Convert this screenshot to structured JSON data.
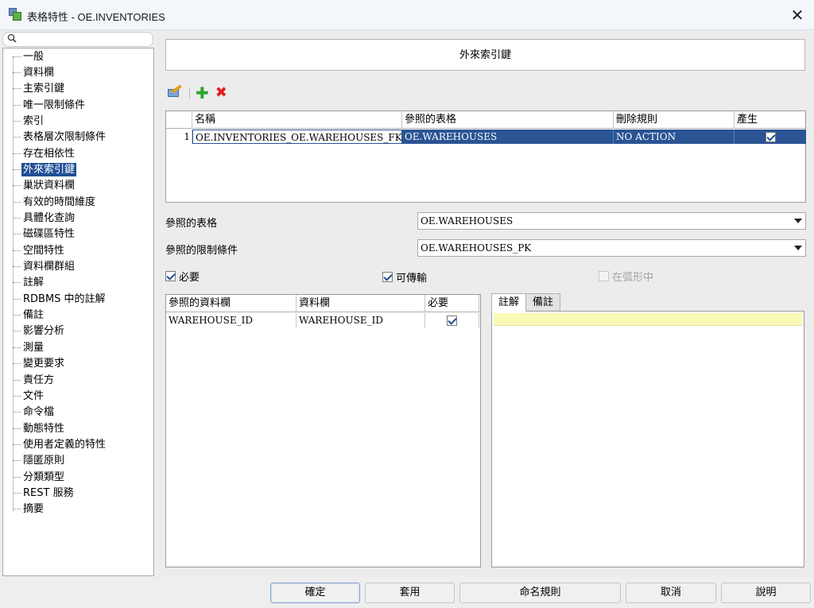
{
  "window": {
    "title": "表格特性 - OE.INVENTORIES",
    "close_glyph": "✕",
    "app_icon": "table-properties-icon"
  },
  "search": {
    "icon": "search-icon",
    "placeholder": ""
  },
  "tree": {
    "items": [
      {
        "label": "一般"
      },
      {
        "label": "資料欄"
      },
      {
        "label": "主索引鍵"
      },
      {
        "label": "唯一限制條件"
      },
      {
        "label": "索引"
      },
      {
        "label": "表格層次限制條件"
      },
      {
        "label": "存在相依性"
      },
      {
        "label": "外來索引鍵",
        "selected": true
      },
      {
        "label": "巢狀資料欄"
      },
      {
        "label": "有效的時間維度"
      },
      {
        "label": "具體化查詢"
      },
      {
        "label": "磁碟區特性"
      },
      {
        "label": "空間特性"
      },
      {
        "label": "資料欄群組"
      },
      {
        "label": "註解"
      },
      {
        "label": "RDBMS 中的註解"
      },
      {
        "label": "備註"
      },
      {
        "label": "影響分析"
      },
      {
        "label": "測量"
      },
      {
        "label": "變更要求"
      },
      {
        "label": "責任方"
      },
      {
        "label": "文件"
      },
      {
        "label": "命令檔"
      },
      {
        "label": "動態特性"
      },
      {
        "label": "使用者定義的特性"
      },
      {
        "label": "隱匿原則"
      },
      {
        "label": "分類類型"
      },
      {
        "label": "REST 服務"
      },
      {
        "label": "摘要"
      }
    ]
  },
  "main": {
    "section_title": "外來索引鍵",
    "toolbar": {
      "edit_icon": "edit-properties-icon",
      "add_icon": "add-icon",
      "add_glyph": "✚",
      "delete_icon": "delete-icon",
      "delete_glyph": "✖"
    },
    "fk_table": {
      "headers": [
        "名稱",
        "參照的表格",
        "刪除規則",
        "產生"
      ],
      "rows": [
        {
          "num": "1",
          "name": "OE.INVENTORIES_OE.WAREHOUSES_FK",
          "ref_table": "OE.WAREHOUSES",
          "delete_rule": "NO ACTION",
          "generate": true
        }
      ]
    },
    "ref_table_label": "參照的表格",
    "ref_table_value": "OE.WAREHOUSES",
    "ref_constraint_label": "參照的限制條件",
    "ref_constraint_value": "OE.WAREHOUSES_PK",
    "mandatory_label": "必要",
    "mandatory_checked": true,
    "transferable_label": "可傳輸",
    "transferable_checked": true,
    "in_arc_label": "在弧形中",
    "in_arc_checked": false,
    "column_table": {
      "headers": [
        "參照的資料欄",
        "資料欄",
        "必要"
      ],
      "rows": [
        {
          "ref_col": "WAREHOUSE_ID",
          "col": "WAREHOUSE_ID",
          "mandatory": true
        }
      ]
    },
    "tabs": [
      "註解",
      "備註"
    ],
    "active_tab": "註解",
    "comment_value": ""
  },
  "buttons": {
    "ok": "確定",
    "apply": "套用",
    "naming_rules": "命名規則",
    "cancel": "取消",
    "help": "說明"
  }
}
